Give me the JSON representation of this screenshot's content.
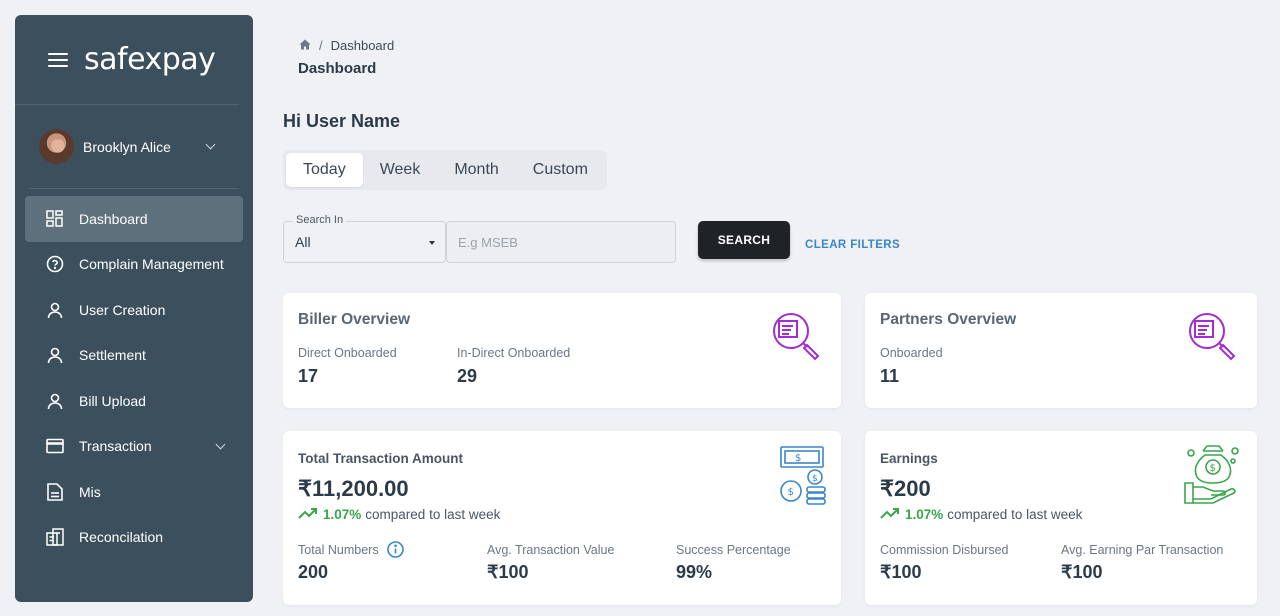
{
  "brand": {
    "logo": "safexpay"
  },
  "user": {
    "name": "Brooklyn Alice"
  },
  "nav": [
    {
      "label": "Dashboard",
      "icon": "dashboard-icon",
      "active": true
    },
    {
      "label": "Complain Management",
      "icon": "question-circle-icon"
    },
    {
      "label": "User Creation",
      "icon": "user-icon"
    },
    {
      "label": "Settlement",
      "icon": "user-icon"
    },
    {
      "label": "Bill Upload",
      "icon": "user-icon"
    },
    {
      "label": "Transaction",
      "icon": "card-icon",
      "has_submenu": true
    },
    {
      "label": "Mis",
      "icon": "document-icon"
    },
    {
      "label": "Reconcilation",
      "icon": "reconcile-icon"
    }
  ],
  "breadcrumb": {
    "item": "Dashboard",
    "separator": "/"
  },
  "page_title": "Dashboard",
  "greeting": "Hi User Name",
  "tabs": [
    "Today",
    "Week",
    "Month",
    "Custom"
  ],
  "filters": {
    "search_in_label": "Search In",
    "search_in_value": "All",
    "query_placeholder": "E.g MSEB",
    "search_button": "SEARCH",
    "clear_label": "CLEAR FILTERS"
  },
  "biller": {
    "title": "Biller Overview",
    "direct_label": "Direct Onboarded",
    "direct_value": "17",
    "indirect_label": "In-Direct Onboarded",
    "indirect_value": "29"
  },
  "partners": {
    "title": "Partners Overview",
    "onboarded_label": "Onboarded",
    "onboarded_value": "11"
  },
  "transactions": {
    "title": "Total Transaction Amount",
    "amount": "₹11,200.00",
    "trend_pct": "1.07%",
    "trend_text": "compared to last week",
    "numbers_label": "Total Numbers",
    "numbers_value": "200",
    "avg_label": "Avg. Transaction Value",
    "avg_value": "₹100",
    "success_label": "Success Percentage",
    "success_value": "99%"
  },
  "earnings": {
    "title": "Earnings",
    "amount": "₹200",
    "trend_pct": "1.07%",
    "trend_text": "compared to last week",
    "commission_label": "Commission Disbursed",
    "commission_value": "₹100",
    "avg_label": "Avg. Earning Par Transaction",
    "avg_value": "₹100"
  },
  "colors": {
    "sidebar": "#3c4f5c",
    "accent_purple": "#a12bd6",
    "accent_blue": "#3a86c9",
    "accent_green": "#3aa54b"
  }
}
